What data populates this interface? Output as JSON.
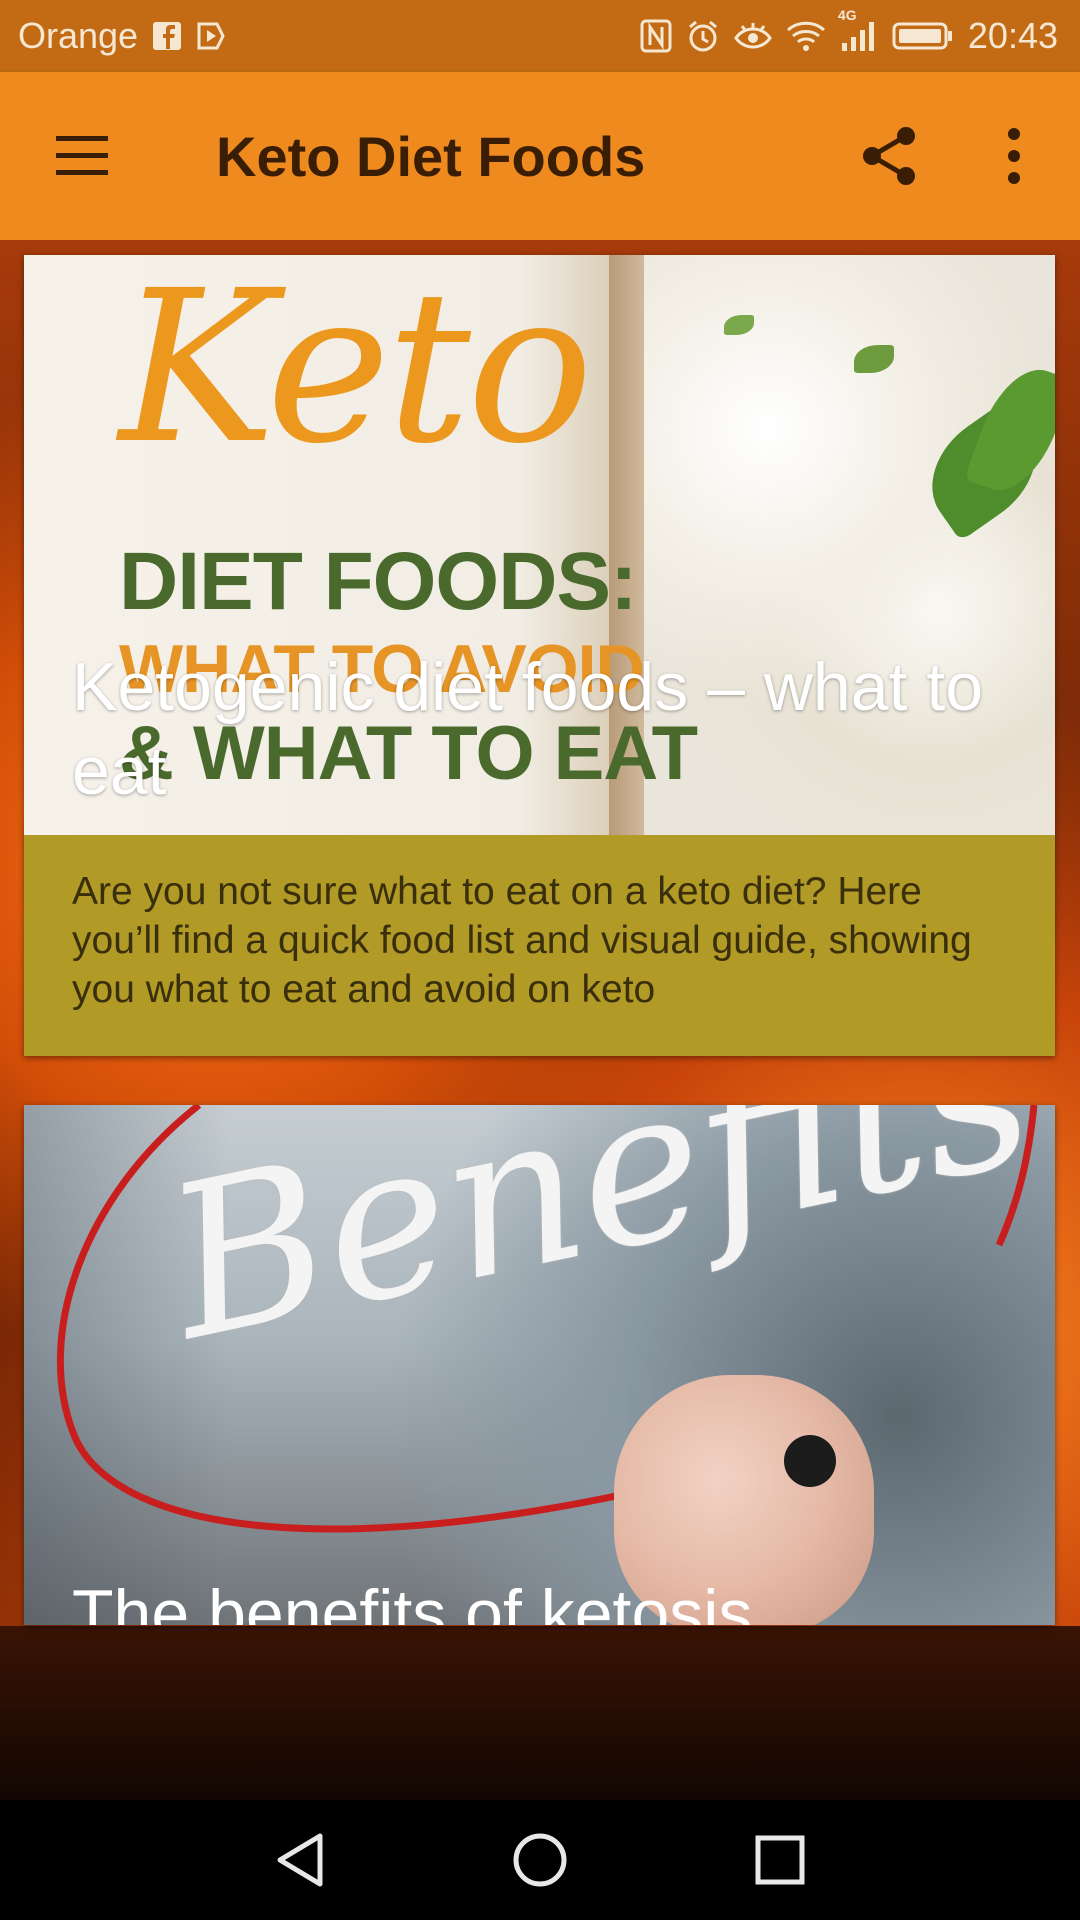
{
  "status_bar": {
    "carrier": "Orange",
    "time": "20:43",
    "network_label": "4G"
  },
  "app_bar": {
    "title": "Keto Diet Foods"
  },
  "cards": [
    {
      "image_text": {
        "keto": "Keto",
        "diet_foods": "DIET FOODS:",
        "avoid": "WHAT TO AVOID",
        "eat": "& WHAT TO EAT"
      },
      "title": "Ketogenic diet foods – what to eat",
      "description": "Are you not sure what to eat on a keto diet? Here you’ll find a quick food list and visual guide, showing you what to eat and avoid on keto"
    },
    {
      "image_text": {
        "benefits": "Benefits"
      },
      "title": "The benefits of ketosis"
    }
  ],
  "colors": {
    "status_bar": "#c26b14",
    "app_bar": "#ee8a1e",
    "card_body": "#b19a26"
  },
  "icons": {
    "menu": "hamburger-menu-icon",
    "share": "share-icon",
    "more": "more-vert-icon",
    "back": "back-triangle-icon",
    "home": "home-circle-icon",
    "recents": "recents-square-icon"
  }
}
